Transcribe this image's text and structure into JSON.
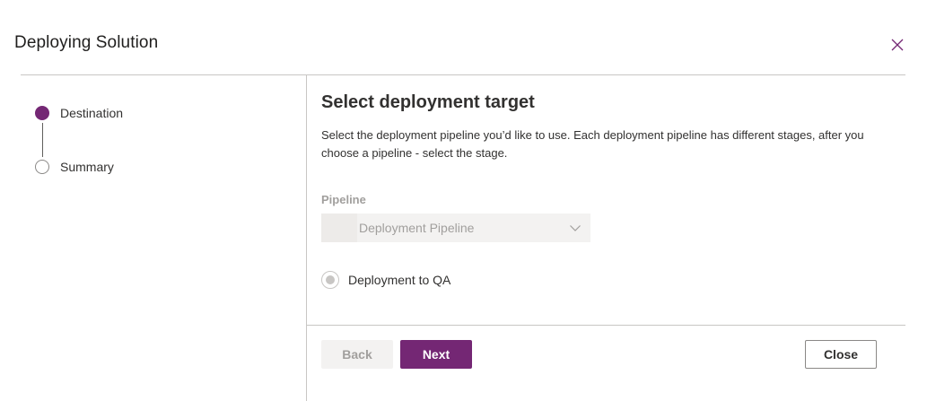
{
  "dialog": {
    "title": "Deploying Solution"
  },
  "steps": [
    {
      "label": "Destination",
      "state": "current"
    },
    {
      "label": "Summary",
      "state": "pending"
    }
  ],
  "main": {
    "heading": "Select deployment target",
    "description": "Select the deployment pipeline you’d like to use. Each deployment pipeline has different stages, after you choose a pipeline - select the stage.",
    "pipeline_label": "Pipeline",
    "pipeline_value": "Deployment Pipeline",
    "stage_option": "Deployment to QA"
  },
  "footer": {
    "back_label": "Back",
    "next_label": "Next",
    "close_label": "Close"
  },
  "colors": {
    "accent": "#742774",
    "disabled_text": "#a19f9d",
    "divider": "#c8c6c4"
  },
  "icons": {
    "close": "close-icon",
    "dropdown": "chevron-down-icon"
  }
}
